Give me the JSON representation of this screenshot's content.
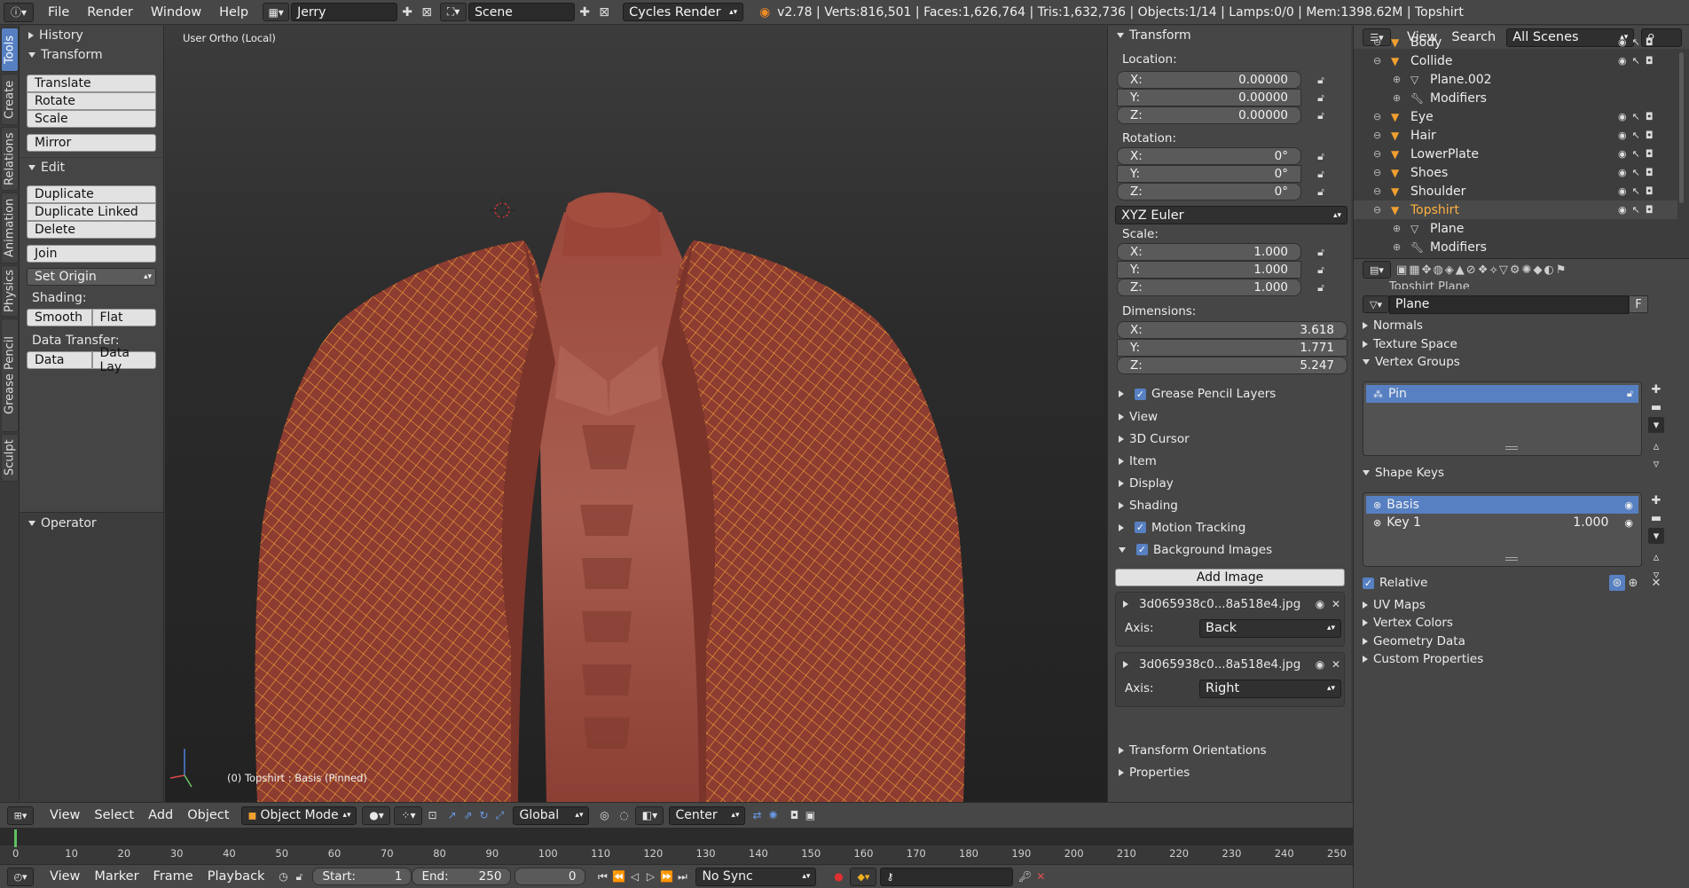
{
  "topbar": {
    "menus": [
      "File",
      "Render",
      "Window",
      "Help"
    ],
    "screen_name": "Jerry",
    "scene_name": "Scene",
    "render_engine": "Cycles Render",
    "stats": "v2.78 | Verts:816,501 | Faces:1,626,764 | Tris:1,632,736 | Objects:1/14 | Lamps:0/0 | Mem:1398.62M | Topshirt"
  },
  "tool_tabs": [
    "Tools",
    "Create",
    "Relations",
    "Animation",
    "Physics",
    "Grease Pencil",
    "Sculpt"
  ],
  "toolshelf": {
    "history": "History",
    "transform": "Transform",
    "translate": "Translate",
    "rotate": "Rotate",
    "scale": "Scale",
    "mirror": "Mirror",
    "edit": "Edit",
    "duplicate": "Duplicate",
    "duplicate_linked": "Duplicate Linked",
    "delete": "Delete",
    "join": "Join",
    "set_origin": "Set Origin",
    "shading_label": "Shading:",
    "smooth": "Smooth",
    "flat": "Flat",
    "data_transfer_label": "Data Transfer:",
    "data": "Data",
    "data_lay": "Data Lay",
    "operator": "Operator"
  },
  "viewport": {
    "view_label": "User Ortho (Local)",
    "object_info": "(0) Topshirt : Basis (Pinned)"
  },
  "npanel": {
    "transform": "Transform",
    "location_label": "Location:",
    "location": [
      {
        "axis": "X:",
        "value": "0.00000"
      },
      {
        "axis": "Y:",
        "value": "0.00000"
      },
      {
        "axis": "Z:",
        "value": "0.00000"
      }
    ],
    "rotation_label": "Rotation:",
    "rotation": [
      {
        "axis": "X:",
        "value": "0°"
      },
      {
        "axis": "Y:",
        "value": "0°"
      },
      {
        "axis": "Z:",
        "value": "0°"
      }
    ],
    "rotation_mode": "XYZ Euler",
    "scale_label": "Scale:",
    "scale": [
      {
        "axis": "X:",
        "value": "1.000"
      },
      {
        "axis": "Y:",
        "value": "1.000"
      },
      {
        "axis": "Z:",
        "value": "1.000"
      }
    ],
    "dimensions_label": "Dimensions:",
    "dimensions": [
      {
        "axis": "X:",
        "value": "3.618"
      },
      {
        "axis": "Y:",
        "value": "1.771"
      },
      {
        "axis": "Z:",
        "value": "5.247"
      }
    ],
    "grease_pencil_layers": "Grease Pencil Layers",
    "view": "View",
    "cursor_3d": "3D Cursor",
    "item": "Item",
    "display": "Display",
    "shading": "Shading",
    "motion_tracking": "Motion Tracking",
    "background_images": "Background Images",
    "add_image": "Add Image",
    "bg_images": [
      {
        "file": "3d065938c0...8a518e4.jpg",
        "axis_label": "Axis:",
        "axis": "Back"
      },
      {
        "file": "3d065938c0...8a518e4.jpg",
        "axis_label": "Axis:",
        "axis": "Right"
      }
    ],
    "transform_orientations": "Transform Orientations",
    "properties": "Properties"
  },
  "outliner": {
    "menus": [
      "View",
      "Search"
    ],
    "scene_filter": "All Scenes",
    "rows": [
      {
        "name": "Body",
        "indent": 0
      },
      {
        "name": "Collide",
        "indent": 0
      },
      {
        "name": "Plane.002",
        "indent": 1
      },
      {
        "name": "Modifiers",
        "indent": 1
      },
      {
        "name": "Eye",
        "indent": 0
      },
      {
        "name": "Hair",
        "indent": 0
      },
      {
        "name": "LowerPlate",
        "indent": 0
      },
      {
        "name": "Shoes",
        "indent": 0
      },
      {
        "name": "Shoulder",
        "indent": 0
      },
      {
        "name": "Topshirt",
        "indent": 0
      },
      {
        "name": "Plane",
        "indent": 1
      },
      {
        "name": "Modifiers",
        "indent": 1
      }
    ]
  },
  "properties": {
    "breadcrumb": "Topshirt   Plane",
    "mesh_name": "Plane",
    "fake_user": "F",
    "normals": "Normals",
    "texture_space": "Texture Space",
    "vertex_groups": "Vertex Groups",
    "vertex_group_items": [
      "Pin"
    ],
    "shape_keys": "Shape Keys",
    "shape_key_items": [
      {
        "name": "Basis",
        "value": ""
      },
      {
        "name": "Key 1",
        "value": "1.000"
      }
    ],
    "relative": "Relative",
    "uv_maps": "UV Maps",
    "vertex_colors": "Vertex Colors",
    "geometry_data": "Geometry Data",
    "custom_properties": "Custom Properties"
  },
  "viewport_header": {
    "menus": [
      "View",
      "Select",
      "Add",
      "Object"
    ],
    "mode": "Object Mode",
    "orientation": "Global",
    "pivot": "Center"
  },
  "timeline": {
    "ticks": [
      "0",
      "10",
      "20",
      "30",
      "40",
      "50",
      "60",
      "70",
      "80",
      "90",
      "100",
      "110",
      "120",
      "130",
      "140",
      "150",
      "160",
      "170",
      "180",
      "190",
      "200",
      "210",
      "220",
      "230",
      "240",
      "250"
    ],
    "current_frame_fraction": 0.0
  },
  "timeline_header": {
    "menus": [
      "View",
      "Marker",
      "Frame",
      "Playback"
    ],
    "start_label": "Start:",
    "start": "1",
    "end_label": "End:",
    "end": "250",
    "current": "0",
    "sync": "No Sync"
  },
  "colors": {
    "accent": "#5680c2",
    "wire": "#f0a030",
    "skin": "#8a3e33"
  }
}
